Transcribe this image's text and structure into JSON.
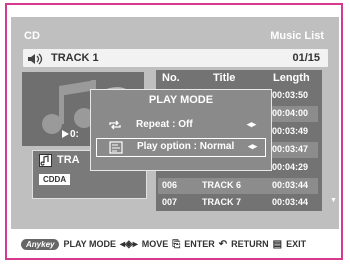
{
  "header": {
    "left": "CD",
    "right": "Music List"
  },
  "track": {
    "name": "TRACK 1",
    "position": "01/15"
  },
  "art": {
    "time": "0:"
  },
  "info": {
    "track": "TRA",
    "format": "CDDA"
  },
  "list": {
    "columns": [
      "No.",
      "Title",
      "Length"
    ],
    "rows": [
      {
        "no": "",
        "title": "",
        "length": "00:03:50"
      },
      {
        "no": "",
        "title": "",
        "length": "00:04:00"
      },
      {
        "no": "",
        "title": "",
        "length": "00:03:49"
      },
      {
        "no": "",
        "title": "",
        "length": "00:03:47"
      },
      {
        "no": "",
        "title": "",
        "length": "00:04:29"
      },
      {
        "no": "006",
        "title": "TRACK 6",
        "length": "00:03:44"
      },
      {
        "no": "007",
        "title": "TRACK 7",
        "length": "00:03:44"
      }
    ]
  },
  "popup": {
    "title": "PLAY MODE",
    "options": [
      {
        "label": "Repeat : Off",
        "arrow": "◂▸"
      },
      {
        "label": "Play option : Normal",
        "arrow": "◂▸"
      }
    ]
  },
  "footer": {
    "anykey": "Anykey",
    "play_mode": "PLAY MODE",
    "move": "MOVE",
    "enter": "ENTER",
    "return": "RETURN",
    "exit": "EXIT"
  },
  "colors": {
    "frame": "#d63a8e",
    "screen": "#bfbfbf",
    "list": "#737373",
    "popup": "#8a8a8a"
  }
}
